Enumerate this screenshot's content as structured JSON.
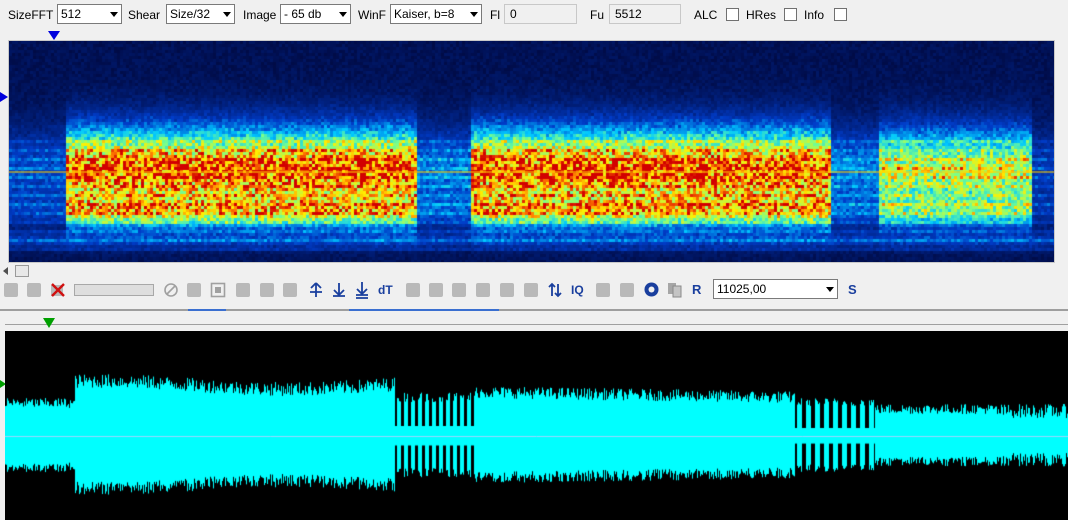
{
  "toolbar_top": {
    "sizefft_label": "SizeFFT",
    "sizefft_value": "512",
    "shear_label": "Shear",
    "shear_value": "Size/32",
    "image_label": "Image",
    "image_value": "- 65 db",
    "winf_label": "WinF",
    "winf_value": "Kaiser, b=8",
    "fl_label": "Fl",
    "fl_value": "0",
    "fu_label": "Fu",
    "fu_value": "5512",
    "alc_label": "ALC",
    "hres_label": "HRes",
    "info_label": "Info"
  },
  "tools": {
    "dt_label": "dT",
    "iq_label": "IQ",
    "r_label": "R",
    "sample_rate_value": "11025,00",
    "s_label": "S"
  },
  "colors": {
    "spectrogram_bg": "#000b46",
    "waveform": "#00ffff",
    "waveform_bg": "#000000",
    "marker_blue": "#0000dd",
    "marker_green": "#00a000"
  }
}
